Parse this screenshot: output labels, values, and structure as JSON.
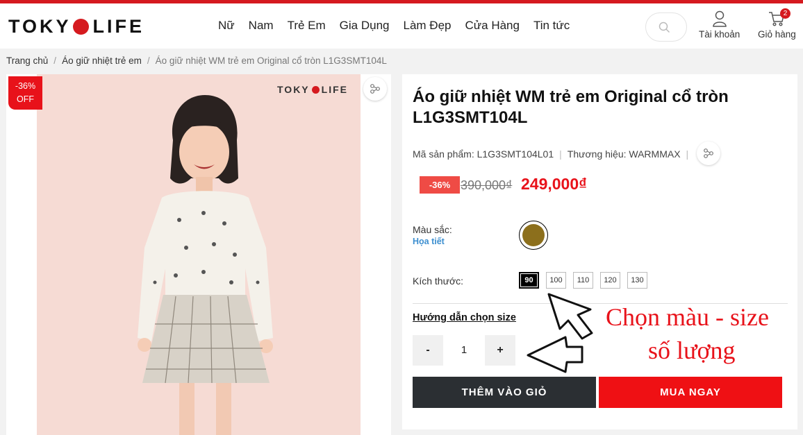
{
  "header": {
    "logo_left": "TOKY",
    "logo_right": "LIFE",
    "nav": [
      "Nữ",
      "Nam",
      "Trẻ Em",
      "Gia Dụng",
      "Làm Đẹp",
      "Cửa Hàng",
      "Tin tức"
    ],
    "account_label": "Tài khoản",
    "cart_label": "Giỏ hàng",
    "cart_count": "2",
    "accent_color": "#d51a1f"
  },
  "breadcrumb": [
    "Trang chủ",
    "Áo giữ nhiệt trẻ em",
    "Áo giữ nhiệt WM trẻ em Original cổ tròn L1G3SMT104L"
  ],
  "gallery": {
    "sale_line1": "-36%",
    "sale_line2": "OFF",
    "photo_logo_left": "TOKY",
    "photo_logo_right": "LIFE"
  },
  "product": {
    "title": "Áo giữ nhiệt WM trẻ em Original cổ tròn L1G3SMT104L",
    "sku_label": "Mã sản phẩm:",
    "sku": "L1G3SMT104L01",
    "brand_label": "Thương hiệu:",
    "brand": "WARMMAX",
    "discount": "-36%",
    "old_price": "390,000₫",
    "new_price": "249,000₫",
    "color_label": "Màu sắc:",
    "color_value": "Họa tiết",
    "swatch_color": "#8c6f1c",
    "size_label": "Kích thước:",
    "sizes": [
      "90",
      "100",
      "110",
      "120",
      "130"
    ],
    "selected_size": "90",
    "size_guide": "Hướng dẫn chọn size",
    "qty_minus": "-",
    "quantity": "1",
    "qty_plus": "+",
    "add_to_cart": "THÊM VÀO GIỎ",
    "buy_now": "MUA NGAY"
  },
  "annotation": {
    "line1": "Chọn màu - size",
    "line2": "số lượng"
  }
}
